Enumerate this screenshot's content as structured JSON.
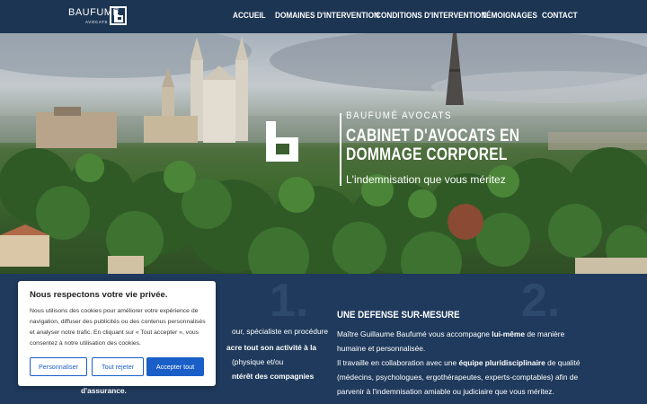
{
  "nav": {
    "logo_text": "BAUFUMÉ",
    "logo_sub": "AVOCATS",
    "items": [
      "ACCUEIL",
      "DOMAINES D'INTERVENTION",
      "CONDITIONS D'INTERVENTION",
      "TÉMOIGNAGES",
      "CONTACT"
    ]
  },
  "hero": {
    "kicker": "BAUFUMÉ AVOCATS",
    "title": "CABINET D'AVOCATS EN DOMMAGE CORPOREL",
    "tagline": "L'indemnisation que vous méritez"
  },
  "sections": {
    "num1": "1.",
    "num2": "2.",
    "left_lines": [
      "our, spécialiste en procédure",
      "acre tout son activité à la",
      "(physique et/ou",
      "ntérêt des compagnies",
      "d'assurance."
    ],
    "right_title": "UNE DEFENSE SUR-MESURE",
    "right_p1_a": "Maître Guillaume Baufumé vous accompagne ",
    "right_p1_b": "lui-même",
    "right_p1_c": " de manière humaine et personnalisée.",
    "right_p2_a": "Il travaille en collaboration avec une ",
    "right_p2_b": "équipe pluridisciplinaire",
    "right_p2_c": " de qualité (médecins, psychologues, ergothérapeutes, experts-comptables) afin de parvenir à l'indemnisation amiable ou judiciaire que vous méritez."
  },
  "cookie": {
    "title": "Nous respectons votre vie privée.",
    "text": "Nous utilisons des cookies pour améliorer votre expérience de navigation, diffuser des publicités ou des contenus personnalisés et analyser notre trafic. En cliquant sur « Tout accepter », vous consentez à notre utilisation des cookies.",
    "btn_customize": "Personnaliser",
    "btn_reject": "Tout rejeter",
    "btn_accept": "Accepter tout"
  },
  "colors": {
    "navy": "#1c3553",
    "section": "#1f3a5c",
    "accent": "#1a5fc7"
  }
}
